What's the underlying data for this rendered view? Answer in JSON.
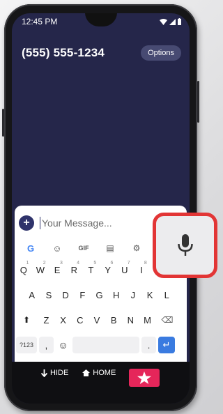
{
  "status_bar": {
    "time": "12:45 PM"
  },
  "header": {
    "phone_number": "(555) 555-1234",
    "options_label": "Options"
  },
  "compose": {
    "add_label": "+",
    "placeholder": "Your Message..."
  },
  "toolbar": {
    "items": [
      {
        "icon": "google-icon",
        "label": "G"
      },
      {
        "icon": "sticker-icon",
        "label": "☺"
      },
      {
        "icon": "gif-icon",
        "label": "GIF"
      },
      {
        "icon": "clipboard-icon",
        "label": "▤"
      },
      {
        "icon": "settings-icon",
        "label": "⚙"
      }
    ]
  },
  "keyboard": {
    "row1": [
      "Q",
      "W",
      "E",
      "R",
      "T",
      "Y",
      "U",
      "I"
    ],
    "row1_hints": [
      "1",
      "2",
      "3",
      "4",
      "5",
      "6",
      "7",
      "8"
    ],
    "row2": [
      "A",
      "S",
      "D",
      "F",
      "G",
      "H",
      "J",
      "K",
      "L"
    ],
    "row3": [
      "Z",
      "X",
      "C",
      "V",
      "B",
      "N",
      "M"
    ],
    "shift": "⬆",
    "backspace": "⌫",
    "symbols": "?123",
    "comma": ",",
    "emoji": "☺",
    "period": ".",
    "enter": "↵"
  },
  "bottom_nav": {
    "hide_label": "HIDE",
    "home_label": "HOME"
  },
  "colors": {
    "screen_bg": "#25264a",
    "accent": "#2f336b",
    "highlight": "#e23535",
    "star_button": "#e5265a"
  }
}
